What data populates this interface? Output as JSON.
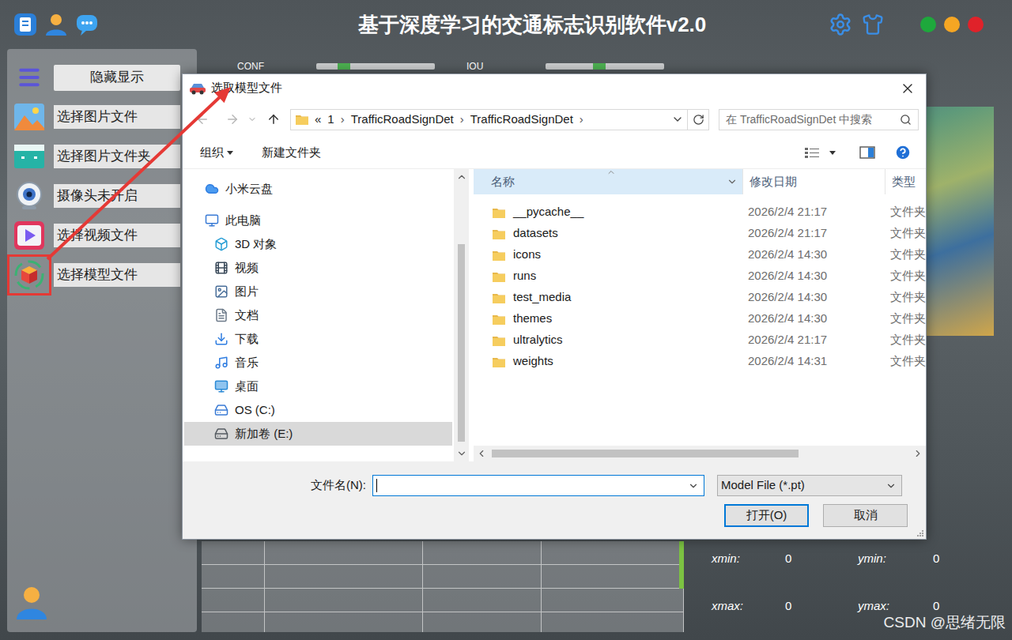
{
  "window": {
    "title": "基于深度学习的交通标志识别软件v2.0",
    "controls": [
      {
        "color": "#1ea83c"
      },
      {
        "color": "#f5a623"
      },
      {
        "color": "#e0222a"
      }
    ]
  },
  "sidebar": {
    "toggle": "隐藏显示",
    "items": [
      {
        "label": "选择图片文件",
        "kind": "image",
        "selected": false
      },
      {
        "label": "选择图片文件夹",
        "kind": "folder",
        "selected": false
      },
      {
        "label": "摄像头未开启",
        "kind": "camera",
        "selected": false
      },
      {
        "label": "选择视频文件",
        "kind": "video",
        "selected": false
      },
      {
        "label": "选择模型文件",
        "kind": "model",
        "selected": true
      }
    ]
  },
  "sliders": [
    {
      "label": "CONF",
      "level": 0.2
    },
    {
      "label": "IOU",
      "level": 0.45
    }
  ],
  "table": {
    "rows": [
      [
        "",
        "",
        "",
        ""
      ],
      [
        "",
        "",
        "",
        ""
      ],
      [
        "",
        "",
        "",
        ""
      ],
      [
        "",
        "",
        "",
        ""
      ]
    ]
  },
  "coords": [
    {
      "label": "xmin:",
      "value": "0"
    },
    {
      "label": "ymin:",
      "value": "0"
    },
    {
      "label": "xmax:",
      "value": "0"
    },
    {
      "label": "ymax:",
      "value": "0"
    }
  ],
  "watermark": "CSDN @思绪无限",
  "dialog": {
    "title": "选取模型文件",
    "back_disabled": true,
    "forward_disabled": true,
    "overflow": "«",
    "separator": "›",
    "breadcrumb": [
      "1",
      "TrafficRoadSignDet",
      "TrafficRoadSignDet"
    ],
    "search_placeholder": "在 TrafficRoadSignDet 中搜索",
    "toolbar": {
      "organize": "组织",
      "new_folder": "新建文件夹"
    },
    "nav": [
      {
        "label": "小米云盘",
        "kind": "cloud",
        "selected": false,
        "children": []
      },
      {
        "label": "此电脑",
        "kind": "pc",
        "selected": false,
        "children": [
          {
            "label": "3D 对象",
            "kind": "cube",
            "selected": false
          },
          {
            "label": "视频",
            "kind": "video",
            "selected": false
          },
          {
            "label": "图片",
            "kind": "picture",
            "selected": false
          },
          {
            "label": "文档",
            "kind": "doc",
            "selected": false
          },
          {
            "label": "下载",
            "kind": "download",
            "selected": false
          },
          {
            "label": "音乐",
            "kind": "music",
            "selected": false
          },
          {
            "label": "桌面",
            "kind": "desktop",
            "selected": false
          },
          {
            "label": "OS (C:)",
            "kind": "system-drive",
            "selected": false
          },
          {
            "label": "新加卷 (E:)",
            "kind": "drive",
            "selected": true
          }
        ]
      }
    ],
    "columns": [
      {
        "label": "名称",
        "sorted": true
      },
      {
        "label": "修改日期",
        "sorted": false
      },
      {
        "label": "类型",
        "sorted": false
      }
    ],
    "files": [
      {
        "name": "__pycache__",
        "modified": "2026/2/4 21:17",
        "type": "文件夹"
      },
      {
        "name": "datasets",
        "modified": "2026/2/4 21:17",
        "type": "文件夹"
      },
      {
        "name": "icons",
        "modified": "2026/2/4 14:30",
        "type": "文件夹"
      },
      {
        "name": "runs",
        "modified": "2026/2/4 14:30",
        "type": "文件夹"
      },
      {
        "name": "test_media",
        "modified": "2026/2/4 14:30",
        "type": "文件夹"
      },
      {
        "name": "themes",
        "modified": "2026/2/4 14:30",
        "type": "文件夹"
      },
      {
        "name": "ultralytics",
        "modified": "2026/2/4 21:17",
        "type": "文件夹"
      },
      {
        "name": "weights",
        "modified": "2026/2/4 14:31",
        "type": "文件夹"
      }
    ],
    "filename_label": "文件名(N):",
    "filename_value": "",
    "filter": "Model File (*.pt)",
    "buttons": [
      {
        "label": "打开(O)",
        "primary": true
      },
      {
        "label": "取消",
        "primary": false
      }
    ]
  }
}
